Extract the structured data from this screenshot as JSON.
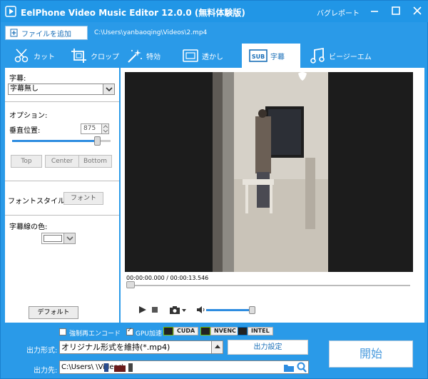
{
  "window": {
    "title": "EelPhone Video Music Editor 12.0.0 (無料体験版)",
    "register_link": "バグレポート",
    "controls": [
      "minimize-icon",
      "maximize-icon",
      "close-icon"
    ]
  },
  "file": {
    "add_label": "ファイルを追加",
    "path": "C:\\Users\\yanbaoqing\\Videos\\2.mp4"
  },
  "tabs": [
    {
      "label": "カット",
      "icon": "scissors-icon",
      "active": false
    },
    {
      "label": "クロップ",
      "icon": "crop-icon",
      "active": false
    },
    {
      "label": "特効",
      "icon": "magic-wand-icon",
      "active": false
    },
    {
      "label": "透かし",
      "icon": "watermark-icon",
      "active": false
    },
    {
      "label": "字幕",
      "icon": "subtitle-icon",
      "active": true
    },
    {
      "label": "ビージーエム",
      "icon": "music-note-icon",
      "active": false
    }
  ],
  "subtitle_panel": {
    "subtitle_label": "字幕:",
    "subtitle_value": "字幕無し",
    "options_label": "オプション:",
    "vertical_label": "垂直位置:",
    "vertical_value": "875",
    "position_buttons": [
      "Top",
      "Center",
      "Bottom"
    ],
    "font_style_label": "フォントスタイル",
    "font_button": "フォント",
    "outline_color_label": "字幕線の色:",
    "outline_color": "#ffffff",
    "default_button": "デフォルト"
  },
  "player": {
    "time": "00:00:00.000 / 00:00:13.546",
    "progress": 0.0,
    "volume": 0.92
  },
  "bottom": {
    "encode_label": "強制再エンコード",
    "encode_checked": false,
    "gpu_label": "GPU加速",
    "gpu_checked": true,
    "gpu_badges": [
      "CUDA",
      "NVENC",
      "INTEL"
    ],
    "format_label": "出力形式:",
    "format_value": "オリジナル形式を維持(*.mp4)",
    "output_settings": "出力設定",
    "dest_label": "出力先:",
    "dest_value": "C:\\Users\\          \\Videos\\",
    "start": "開始"
  },
  "colors": {
    "accent": "#2196e6",
    "slider": "#2d8ce0"
  }
}
